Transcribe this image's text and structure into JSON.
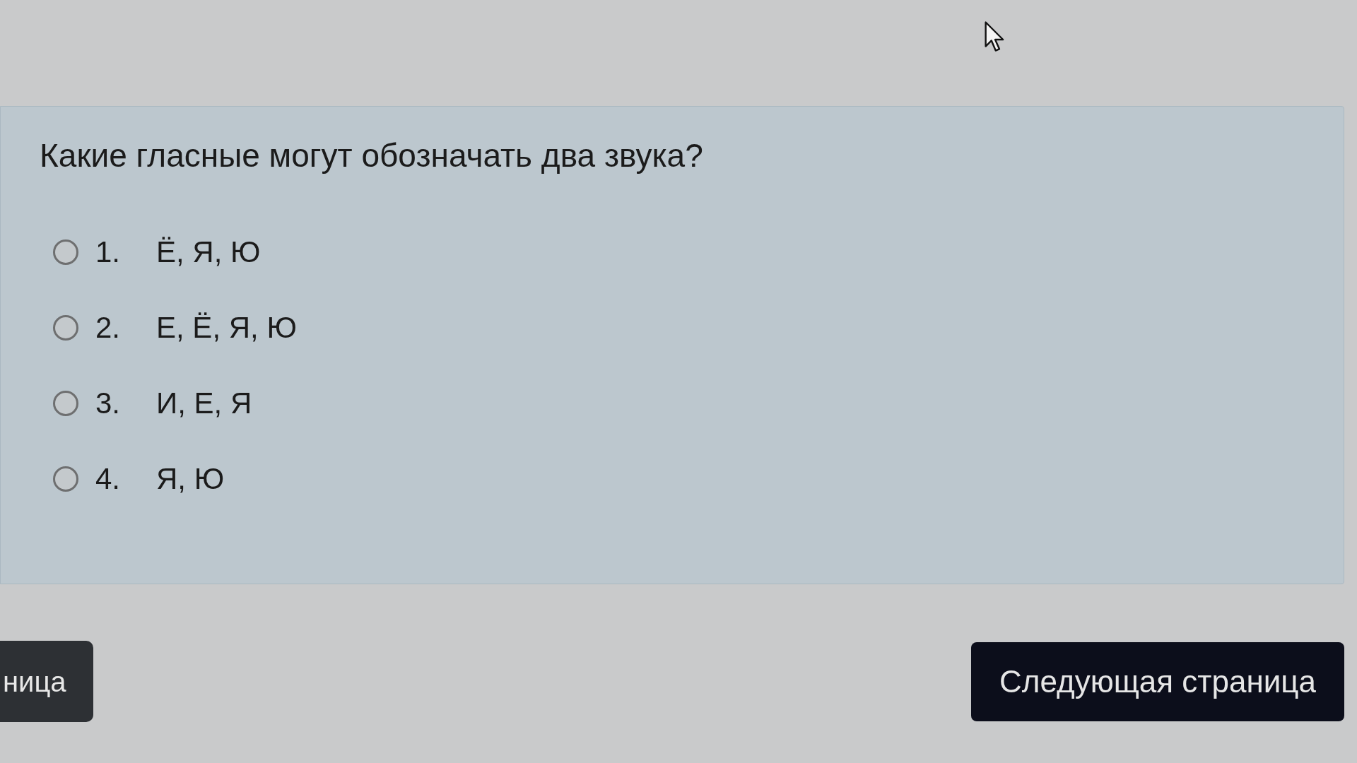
{
  "question": {
    "text": "Какие гласные могут обозначать два звука?"
  },
  "options": [
    {
      "number": "1.",
      "text": "Ё, Я, Ю",
      "selected": false
    },
    {
      "number": "2.",
      "text": "Е, Ё, Я, Ю",
      "selected": false
    },
    {
      "number": "3.",
      "text": "И, Е, Я",
      "selected": false
    },
    {
      "number": "4.",
      "text": "Я, Ю",
      "selected": false
    }
  ],
  "buttons": [
    {
      "kind": "previous",
      "label": "ница"
    },
    {
      "kind": "next",
      "label": "Следующая страница"
    }
  ]
}
